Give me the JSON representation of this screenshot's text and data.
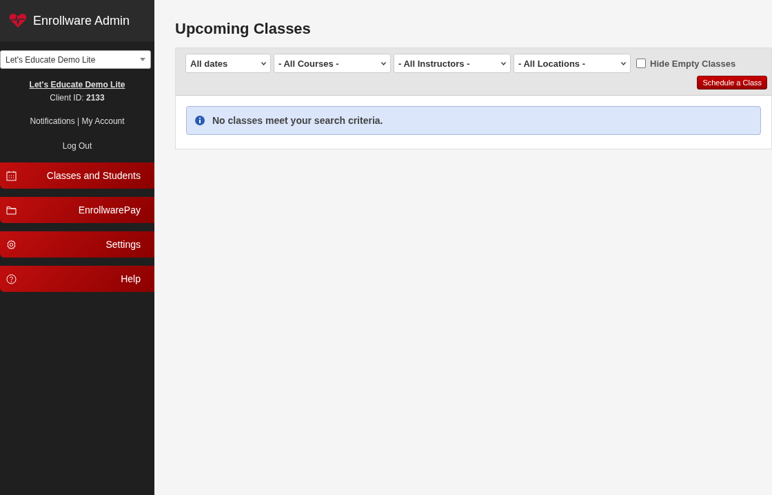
{
  "app": {
    "title": "Enrollware Admin"
  },
  "sidebar": {
    "account_select": "Let's Educate Demo Lite",
    "account_name": "Let's Educate Demo Lite",
    "client_id_label": "Client ID:",
    "client_id": "2133",
    "links": [
      "Notifications",
      "|",
      "My Account"
    ],
    "logout": "Log Out",
    "nav": [
      {
        "label": "Classes and Students",
        "selected": false
      },
      {
        "label": "EnrollwarePay",
        "selected": false
      },
      {
        "label": "Settings",
        "selected": false
      },
      {
        "label": "Help",
        "selected": false
      }
    ]
  },
  "page": {
    "title": "Upcoming Classes",
    "filters": [
      {
        "value": "All dates"
      },
      {
        "value": "- All Courses -"
      },
      {
        "value": "- All Instructors -"
      },
      {
        "value": "- All Locations -"
      }
    ],
    "hide_empty": {
      "label": "Hide Empty Classes",
      "checked": false
    },
    "schedule_button": "Schedule a Class",
    "message": "No classes meet your search criteria."
  }
}
